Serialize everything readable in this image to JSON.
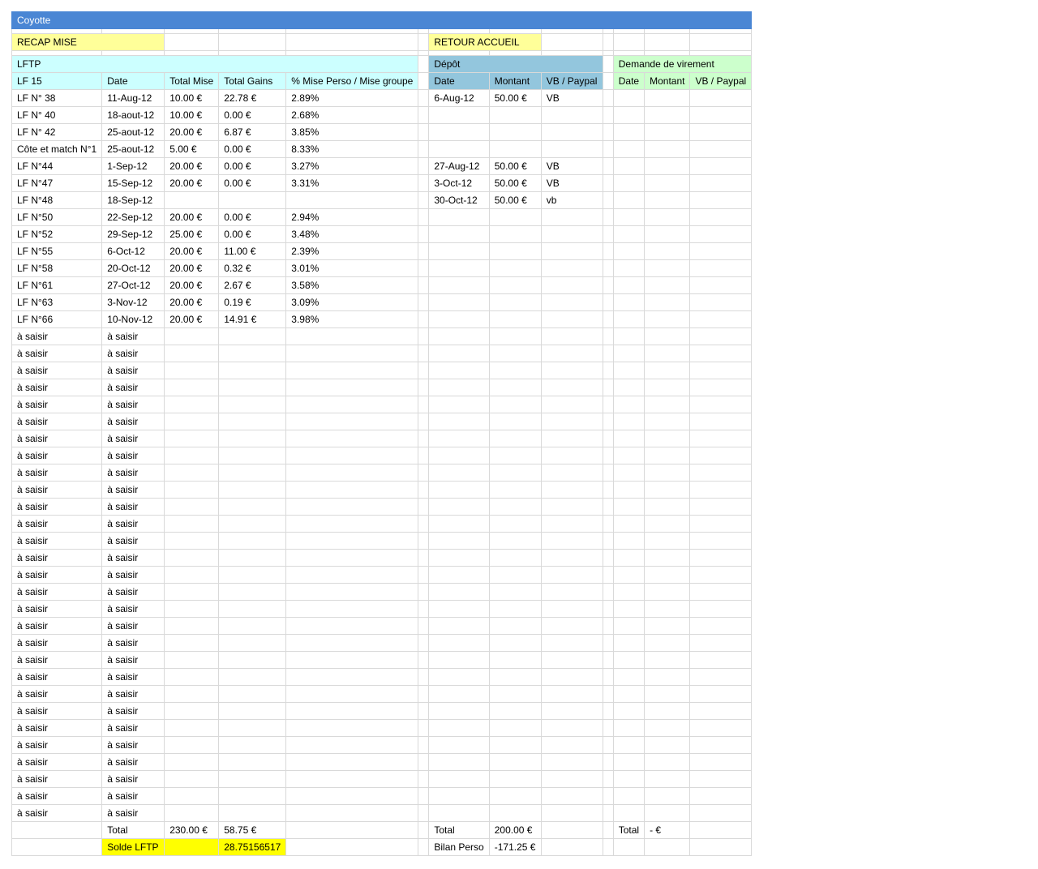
{
  "sheet": {
    "title": "Coyotte",
    "recap_mise": "RECAP MISE",
    "retour_accueil": "RETOUR ACCUEIL",
    "placeholder": "à saisir",
    "lftp": {
      "title": "LFTP",
      "headers": [
        "LF 15",
        "Date",
        "Total Mise",
        "Total Gains",
        "% Mise Perso / Mise groupe"
      ],
      "rows": [
        [
          "LF N° 38",
          "11-Aug-12",
          "10.00 €",
          "22.78 €",
          "2.89%"
        ],
        [
          "LF N° 40",
          "18-aout-12",
          "10.00 €",
          "0.00 €",
          "2.68%"
        ],
        [
          "LF N° 42",
          "25-aout-12",
          "20.00 €",
          "6.87 €",
          "3.85%"
        ],
        [
          "Côte et match N°1",
          "25-aout-12",
          "5.00 €",
          "0.00 €",
          "8.33%"
        ],
        [
          "LF N°44",
          "1-Sep-12",
          "20.00 €",
          "0.00 €",
          "3.27%"
        ],
        [
          "LF N°47",
          "15-Sep-12",
          "20.00 €",
          "0.00 €",
          "3.31%"
        ],
        [
          "LF N°48",
          "18-Sep-12",
          "",
          "",
          ""
        ],
        [
          "LF N°50",
          "22-Sep-12",
          "20.00 €",
          "0.00 €",
          "2.94%"
        ],
        [
          "LF N°52",
          "29-Sep-12",
          "25.00 €",
          "0.00 €",
          "3.48%"
        ],
        [
          "LF N°55",
          "6-Oct-12",
          "20.00 €",
          "11.00 €",
          "2.39%"
        ],
        [
          "LF N°58",
          "20-Oct-12",
          "20.00 €",
          "0.32 €",
          "3.01%"
        ],
        [
          "LF N°61",
          "27-Oct-12",
          "20.00 €",
          "2.67 €",
          "3.58%"
        ],
        [
          "LF N°63",
          "3-Nov-12",
          "20.00 €",
          "0.19 €",
          "3.09%"
        ],
        [
          "LF N°66",
          "10-Nov-12",
          "20.00 €",
          "14.91 €",
          "3.98%"
        ]
      ],
      "placeholder_rows": 29,
      "total_label": "Total",
      "total_mise": "230.00 €",
      "total_gains": "58.75 €",
      "solde_label": "Solde LFTP",
      "solde_value": "28.75156517"
    },
    "depot": {
      "title": "Dépôt",
      "headers": [
        "Date",
        "Montant",
        "VB / Paypal"
      ],
      "rows": [
        [
          "6-Aug-12",
          "50.00 €",
          "VB"
        ],
        [
          "",
          "",
          ""
        ],
        [
          "",
          "",
          ""
        ],
        [
          "",
          "",
          ""
        ],
        [
          "27-Aug-12",
          "50.00 €",
          "VB"
        ],
        [
          "3-Oct-12",
          "50.00 €",
          "VB"
        ],
        [
          "30-Oct-12",
          "50.00 €",
          "vb"
        ]
      ],
      "total_label": "Total",
      "total_value": "200.00 €",
      "bilan_label": "Bilan Perso",
      "bilan_value": "-171.25 €"
    },
    "virement": {
      "title": "Demande de virement",
      "headers": [
        "Date",
        "Montant",
        "VB / Paypal"
      ],
      "total_label": "Total",
      "total_value": "- €"
    }
  }
}
